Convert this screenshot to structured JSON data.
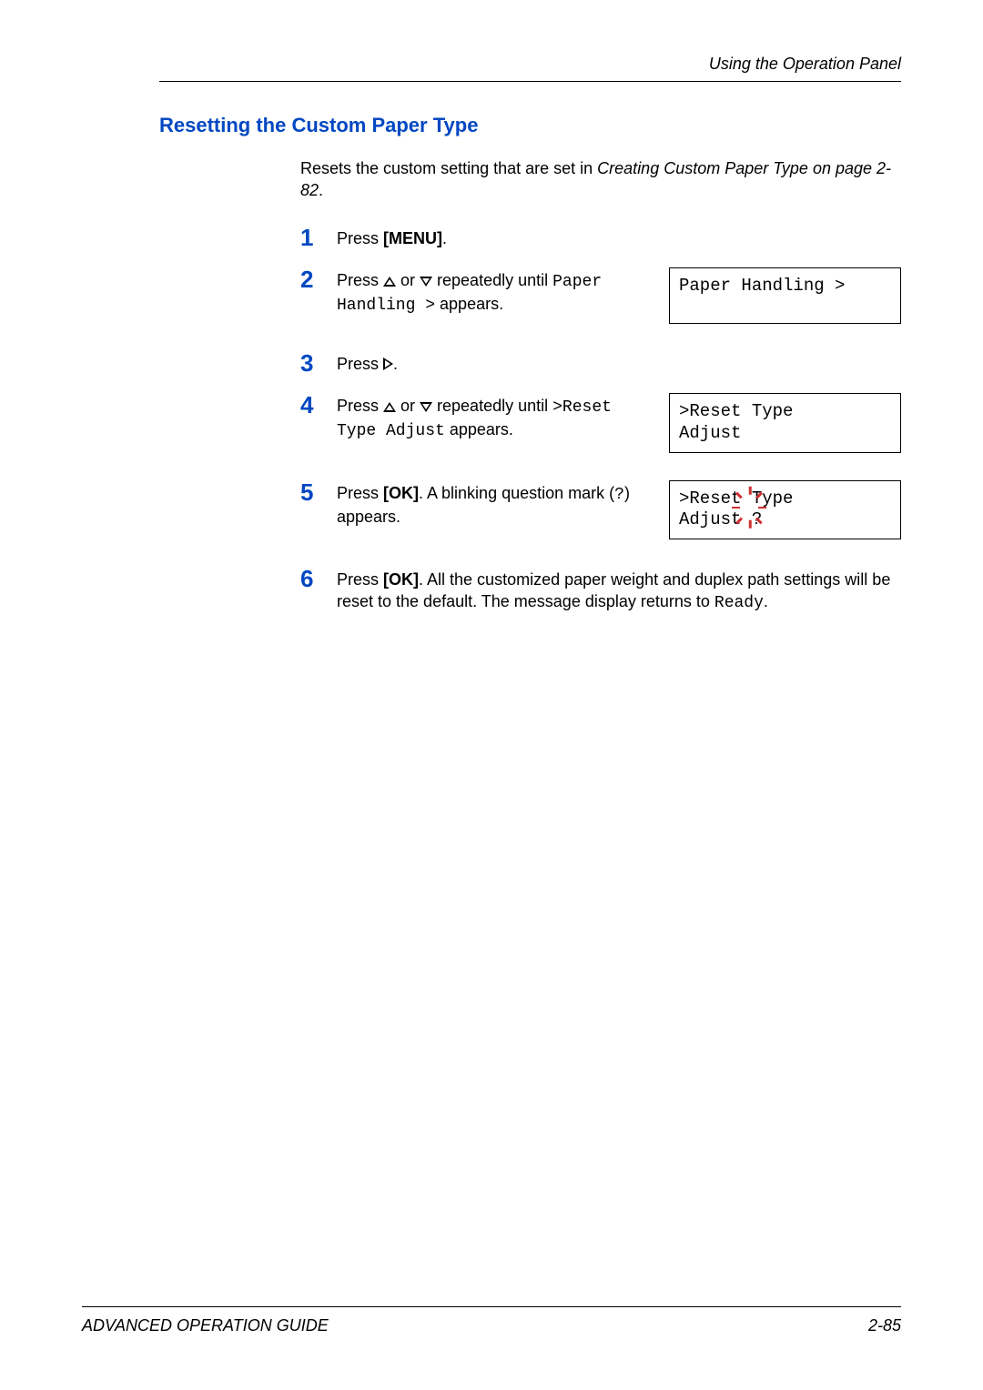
{
  "header": {
    "running_head": "Using the Operation Panel"
  },
  "section": {
    "title": "Resetting the Custom Paper Type",
    "intro_pre": "Resets the custom setting that are set in ",
    "intro_ref": "Creating Custom Paper Type on page 2-82",
    "intro_post": "."
  },
  "steps": {
    "1": {
      "num": "1",
      "t1": "Press ",
      "menu": "[MENU]",
      "t2": "."
    },
    "2": {
      "num": "2",
      "t1": "Press ",
      "t2": " or ",
      "t3": " repeatedly until ",
      "code1": "Paper Handling >",
      "t4": " appears.",
      "display": "Paper Handling >"
    },
    "3": {
      "num": "3",
      "t1": "Press ",
      "t2": "."
    },
    "4": {
      "num": "4",
      "t1": "Press ",
      "t2": " or ",
      "t3": " repeatedly until ",
      "code1": ">Reset Type Adjust",
      "t4": " appears.",
      "display": ">Reset Type\nAdjust"
    },
    "5": {
      "num": "5",
      "t1": "Press ",
      "ok": "[OK]",
      "t2": ". A blinking question mark (",
      "qmark": "?",
      "t3": ") appears.",
      "display_line1": ">Reset Type",
      "display_line2a": "Adjust ",
      "display_q": "?"
    },
    "6": {
      "num": "6",
      "t1": "Press ",
      "ok": "[OK]",
      "t2": ". All the customized paper weight and duplex path settings will be reset to the default. The message display returns to ",
      "code1": "Ready",
      "t3": "."
    }
  },
  "footer": {
    "left": "ADVANCED OPERATION GUIDE",
    "right": "2-85"
  }
}
